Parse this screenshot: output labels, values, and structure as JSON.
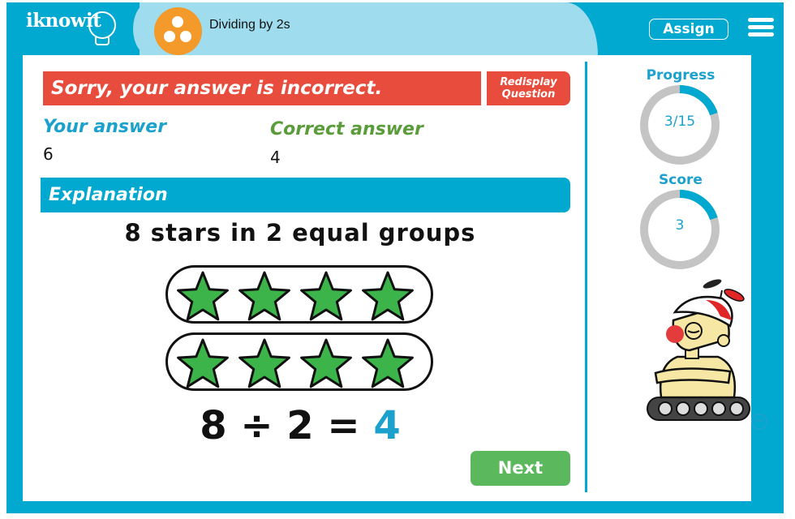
{
  "header": {
    "logo_text": "iknowit",
    "topic_title": "Dividing by 2s",
    "topic_icon": "three-dots-icon",
    "assign_label": "Assign",
    "menu_icon": "hamburger-menu-icon"
  },
  "colors": {
    "frame": "#01a8cf",
    "tab_light": "#9fdcee",
    "incorrect": "#e74c3c",
    "your_answer": "#1ba1cc",
    "correct_answer": "#5a9b3a",
    "next": "#5cb85c",
    "star_fill": "#3cb44a",
    "ring_track": "#c4c4c4",
    "topic_icon": "#f39a2b"
  },
  "feedback": {
    "message": "Sorry, your answer is incorrect.",
    "redisplay_line1": "Redisplay",
    "redisplay_line2": "Question",
    "your_answer_label": "Your answer",
    "your_answer_value": "6",
    "correct_answer_label": "Correct answer",
    "correct_answer_value": "4"
  },
  "explanation": {
    "header": "Explanation",
    "title": "8 stars in 2 equal groups",
    "groups": [
      {
        "stars": 4
      },
      {
        "stars": 4
      }
    ],
    "equation_left": "8 ÷ 2 =",
    "equation_answer": "4"
  },
  "next_label": "Next",
  "sidebar": {
    "progress": {
      "label": "Progress",
      "text": "3/15",
      "current": 3,
      "total": 15
    },
    "score": {
      "label": "Score",
      "text": "3",
      "fraction": 0.2
    },
    "mascot": "robot-mascot-icon",
    "resize_icon": "resize-arrows-icon"
  }
}
